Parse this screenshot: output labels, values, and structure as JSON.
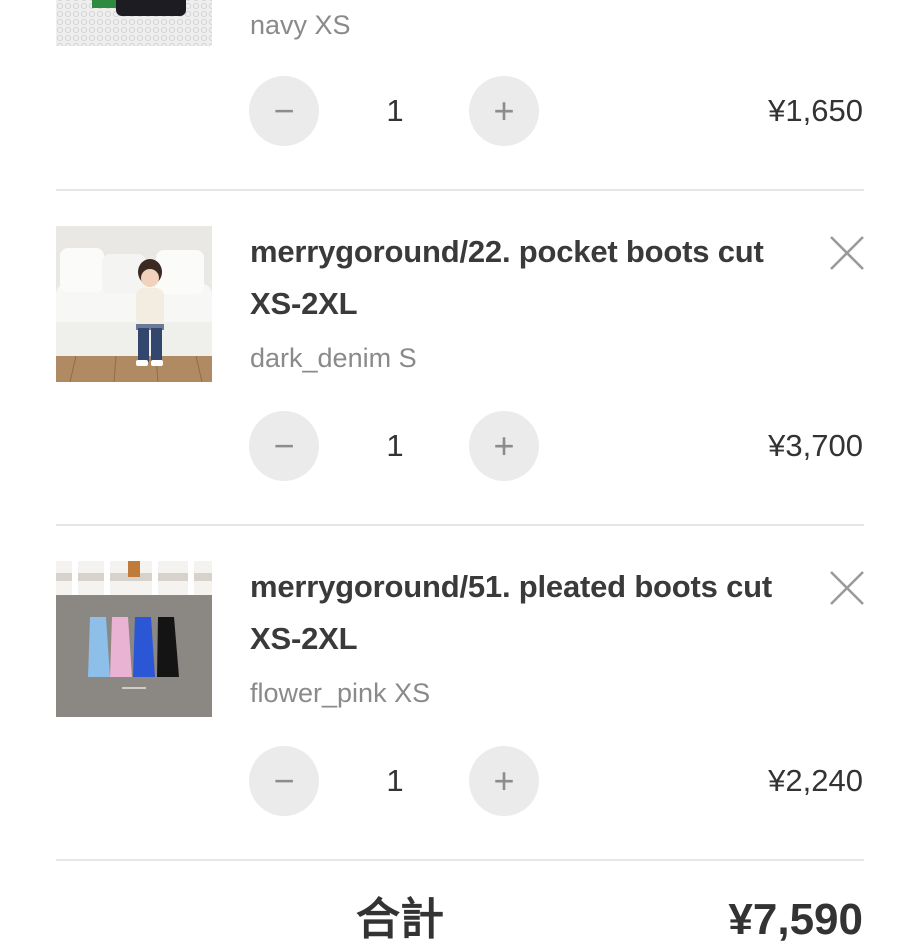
{
  "cart": {
    "items": [
      {
        "title_line1": "",
        "title_line2": "",
        "variant": "navy XS",
        "quantity": "1",
        "price": "¥1,650",
        "minus_symbol": "−",
        "plus_symbol": "+",
        "thumb_icon": "product-photo-black-green-top"
      },
      {
        "title_line1": "merrygoround/22. pocket boots cut",
        "title_line2": "XS-2XL",
        "variant": "dark_denim S",
        "quantity": "1",
        "price": "¥3,700",
        "minus_symbol": "−",
        "plus_symbol": "+",
        "remove_icon": "close-icon",
        "thumb_icon": "product-photo-child-on-sofa"
      },
      {
        "title_line1": "merrygoround/51. pleated boots cut",
        "title_line2": "XS-2XL",
        "variant": "flower_pink XS",
        "quantity": "1",
        "price": "¥2,240",
        "minus_symbol": "−",
        "plus_symbol": "+",
        "remove_icon": "close-icon",
        "thumb_icon": "product-photo-four-pants-flatlay"
      }
    ],
    "summary": {
      "label_partial": "合計",
      "total_partial": "¥7,590"
    }
  },
  "colors": {
    "button_bg": "#ebebeb",
    "divider": "#e6e6e6",
    "variant_text": "#8a8a8a",
    "body_text": "#333333"
  }
}
